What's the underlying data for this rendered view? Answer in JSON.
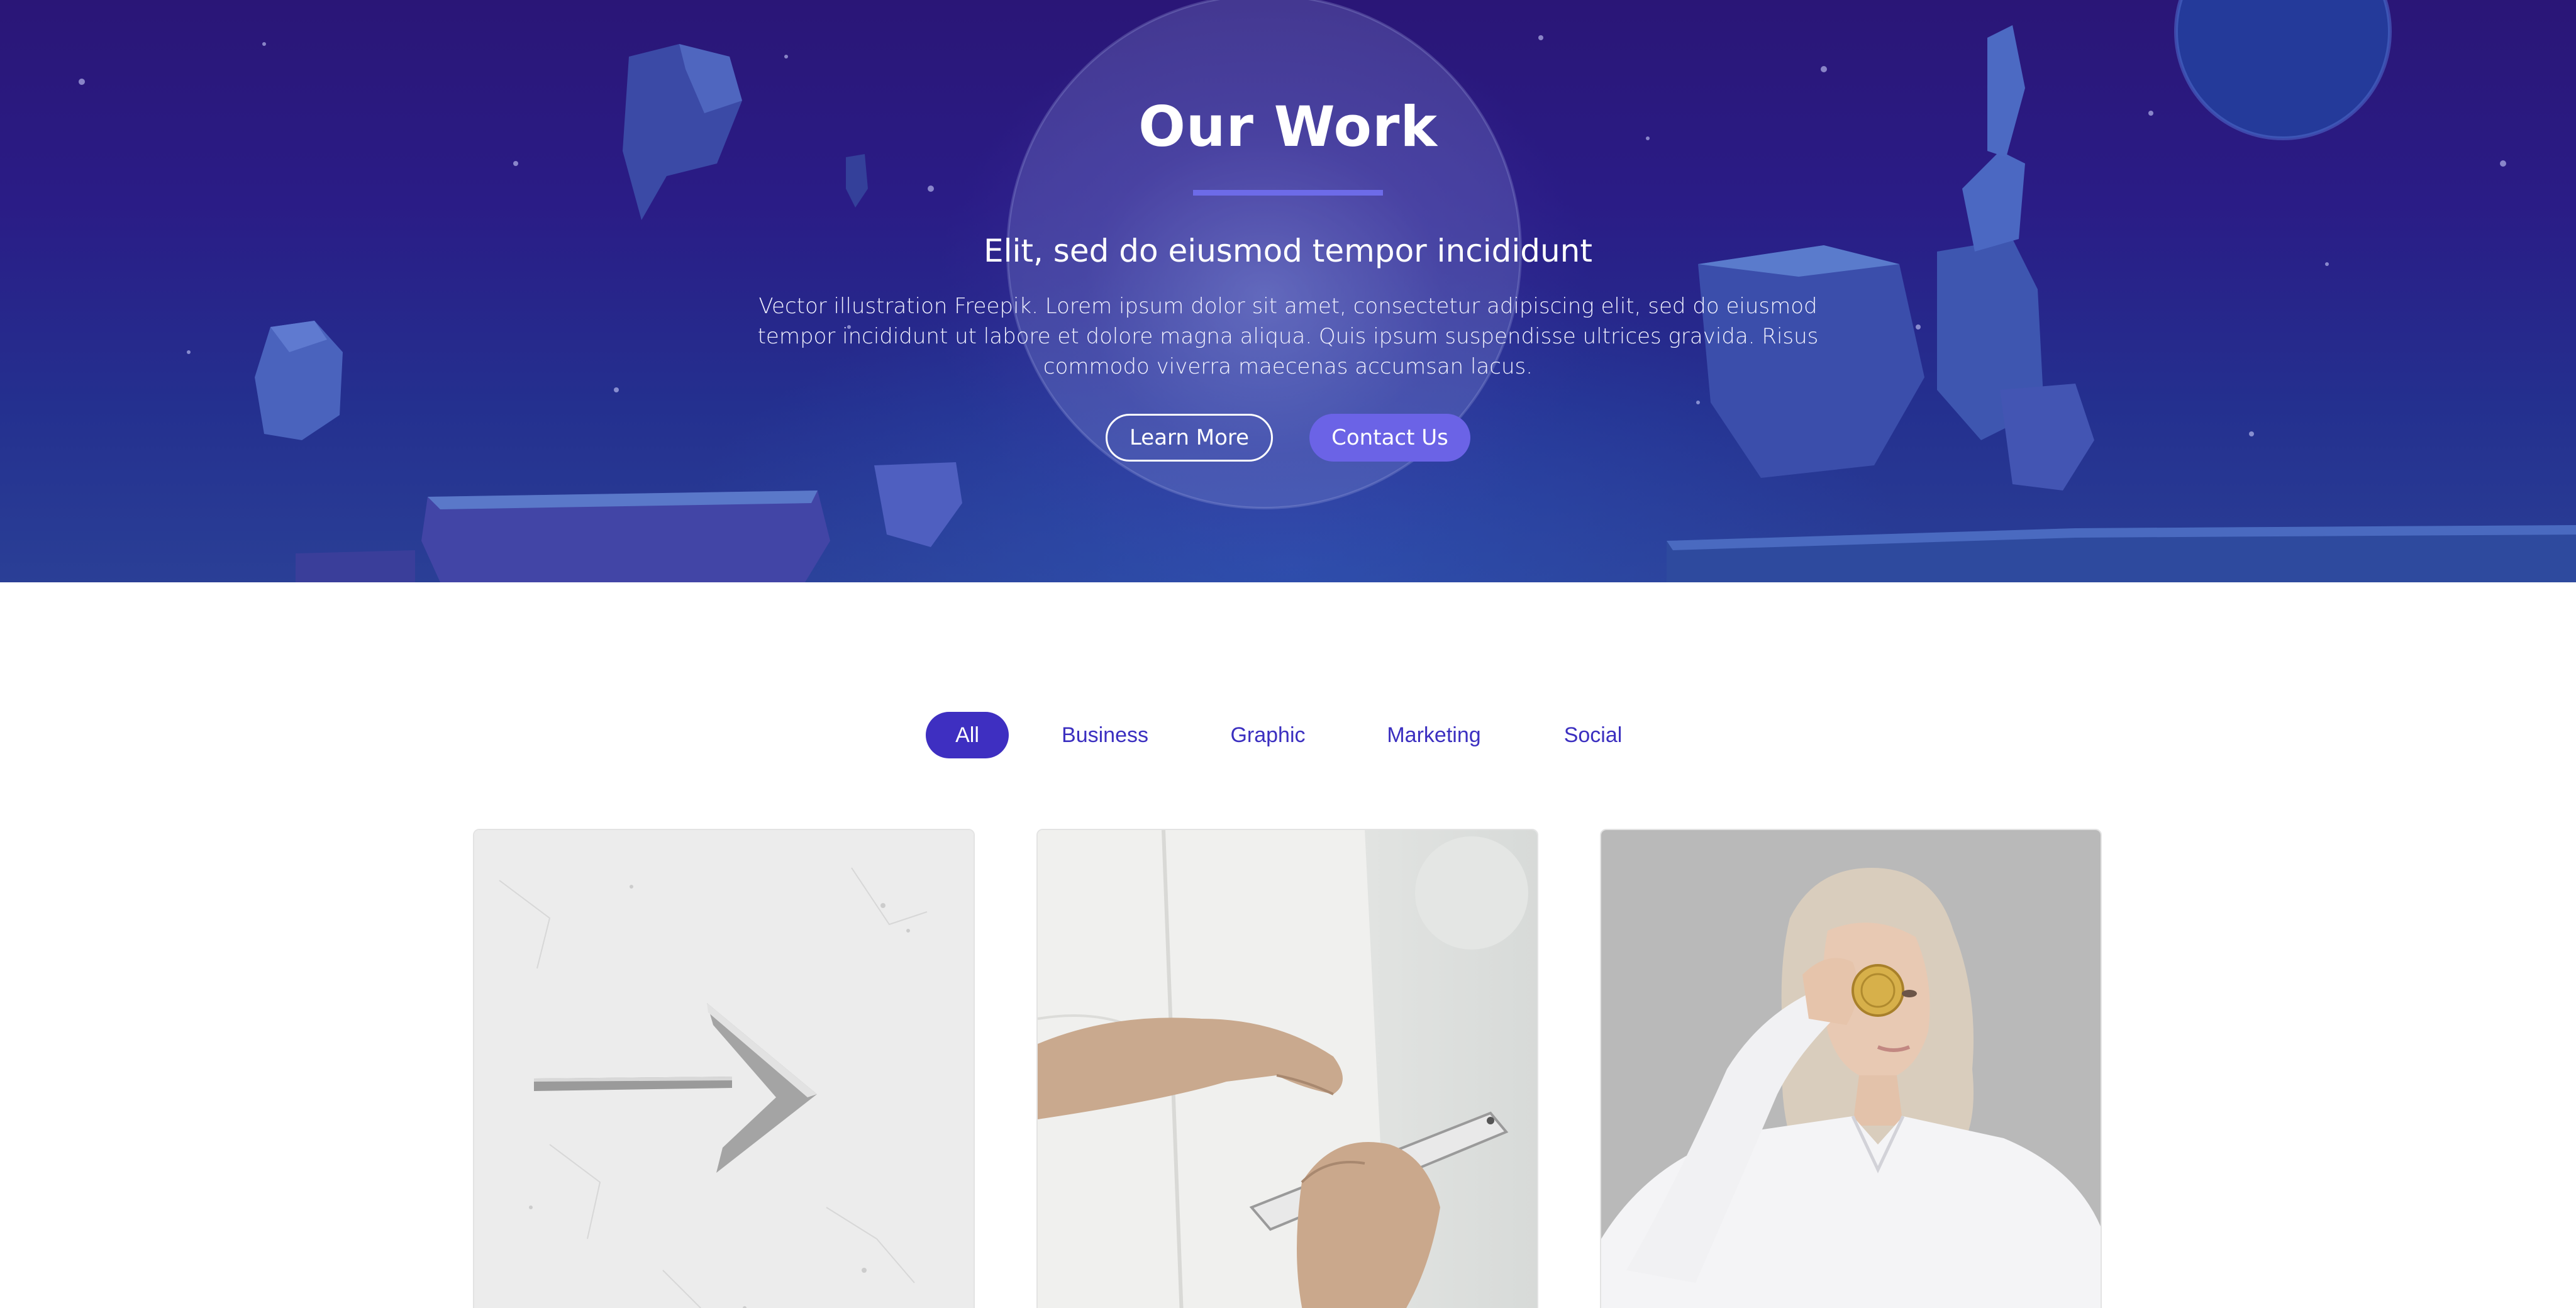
{
  "hero": {
    "title": "Our Work",
    "subtitle": "Elit, sed do eiusmod tempor incididunt",
    "description": "Vector illustration Freepik. Lorem ipsum dolor sit amet, consectetur adipiscing elit, sed do eiusmod tempor incididunt ut labore et dolore magna aliqua. Quis ipsum suspendisse ultrices gravida. Risus commodo viverra maecenas accumsan lacus.",
    "learn_more_label": "Learn More",
    "contact_label": "Contact Us"
  },
  "filters": {
    "items": [
      {
        "label": "All",
        "active": true
      },
      {
        "label": "Business",
        "active": false
      },
      {
        "label": "Graphic",
        "active": false
      },
      {
        "label": "Marketing",
        "active": false
      },
      {
        "label": "Social",
        "active": false
      }
    ]
  },
  "gallery": {
    "items": [
      {
        "subject": "arrow-on-concrete"
      },
      {
        "subject": "hand-touching-smartphone"
      },
      {
        "subject": "woman-holding-coin"
      }
    ]
  },
  "colors": {
    "accent": "#6b63e6",
    "filter_active": "#3e2fc1",
    "filter_text": "#3b2fc0",
    "hero_dark": "#2a1677"
  }
}
